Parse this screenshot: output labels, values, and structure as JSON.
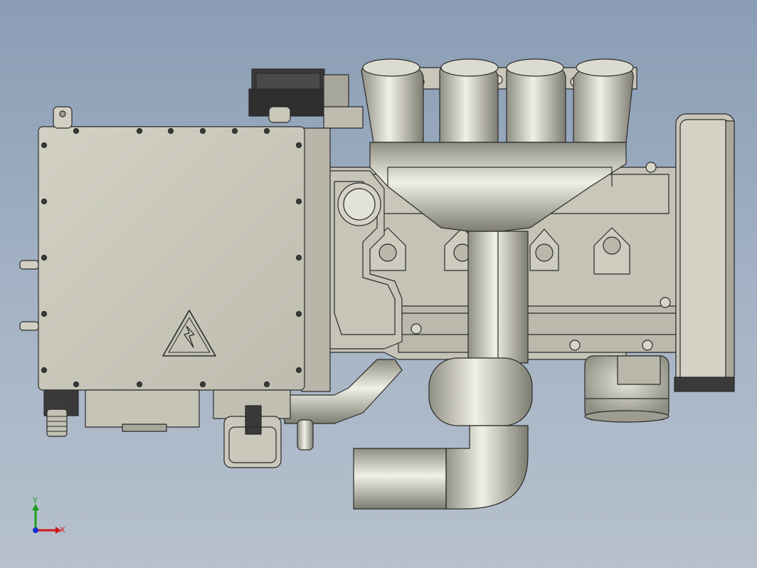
{
  "viewport": {
    "background_top": "#8a9db5",
    "background_bottom": "#b7c1cd",
    "model_fill": "#c9c8bb",
    "model_shade": "#a8a79a",
    "edge_color": "#2b2b2b"
  },
  "triad": {
    "x_label": "X",
    "y_label": "Y",
    "x_color": "#d01818",
    "y_color": "#18a018",
    "z_color": "#1830d0"
  },
  "model": {
    "warning_icon": "high-voltage-warning-icon"
  }
}
